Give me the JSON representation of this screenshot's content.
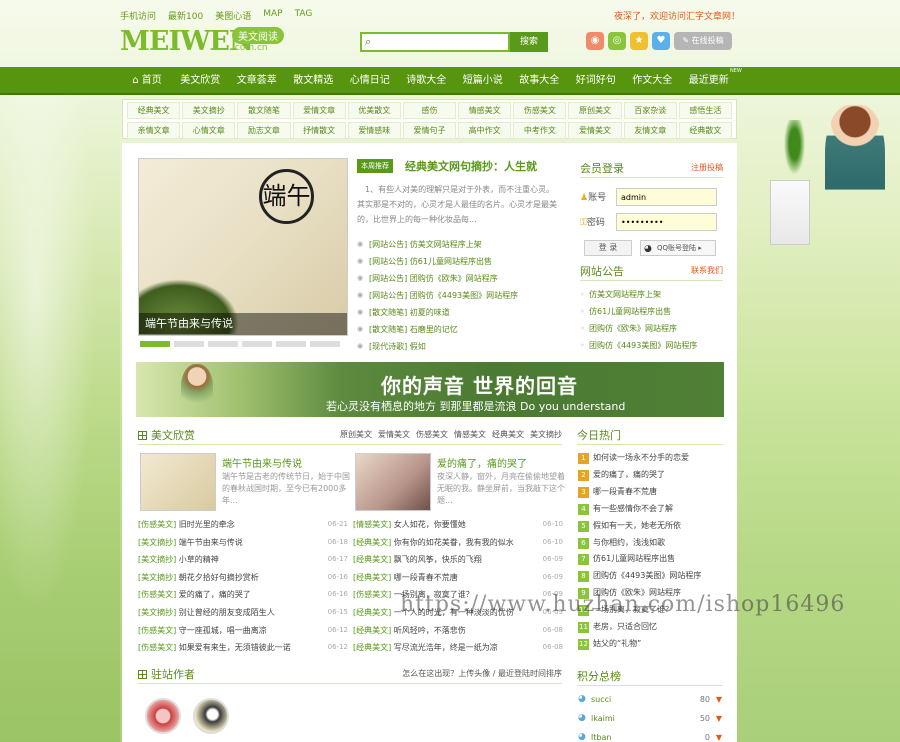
{
  "top_links": [
    "手机访问",
    "最新100",
    "美图心语",
    "MAP",
    "TAG"
  ],
  "welcome": "夜深了，欢迎访问汇字文章网！",
  "logo": {
    "text": "MEIWEN",
    "badge": "美文阅读",
    "domain": ".com.cn"
  },
  "search": {
    "placeholder": "",
    "button": "搜索"
  },
  "social": {
    "online_submit": "在线投稿"
  },
  "nav": {
    "items": [
      "首页",
      "美文欣赏",
      "文章荟萃",
      "散文精选",
      "心情日记",
      "诗歌大全",
      "短篇小说",
      "故事大全",
      "好词好句",
      "作文大全",
      "最近更新"
    ],
    "badge": "NEW"
  },
  "subnav": [
    "经典美文",
    "美文摘抄",
    "散文随笔",
    "爱情文章",
    "优美散文",
    "感伤",
    "情感美文",
    "伤感美文",
    "原创美文",
    "百家杂谈",
    "感悟生活",
    "亲情文章",
    "心情文章",
    "励志文章",
    "抒情散文",
    "爱情感味",
    "爱情句子",
    "高中作文",
    "中考作文",
    "爱情美文",
    "友情文章",
    "经典散文"
  ],
  "slider": {
    "caption": "端午节由来与传说",
    "brush_char": "端午"
  },
  "recommend": {
    "tag": "本周推荐",
    "title": "经典美文网句摘抄：人生就",
    "body": "1、有些人对美的理解只是对于外表，而不注重心灵。其实那是不对的，心灵才是人最佳的名片。心灵才是最美的，比世界上的每一种化妆品每..."
  },
  "notice_list": [
    "[网站公告] 仿美文网站程序上架",
    "[网站公告] 仿61儿童网站程序出售",
    "[网站公告] 团购仿《欧朱》网站程序",
    "[网站公告] 团购仿《4493美图》网站程序",
    "[散文随笔] 初夏的味道",
    "[散文随笔] 石磨里的记忆",
    "[现代诗歌] 假如"
  ],
  "login": {
    "title": "会员登录",
    "register": "注册投稿",
    "account_label": "账号",
    "account_value": "admin",
    "password_label": "密码",
    "password_value": "•••••••••",
    "login_button": "登 录",
    "qq_button": "QQ账号登陆"
  },
  "site_notice": {
    "title": "网站公告",
    "contact": "联系我们",
    "items": [
      "仿美文网站程序上架",
      "仿61儿童网站程序出售",
      "团购仿《欧朱》网站程序",
      "团购仿《4493美图》网站程序"
    ]
  },
  "banner": {
    "line1": "你的声音 世界的回音",
    "line2": "若心灵没有栖息的地方 到那里都是流浪 Do you understand"
  },
  "articles": {
    "title": "美文欣赏",
    "tabs": [
      "原创美文",
      "爱情美文",
      "伤感美文",
      "情感美文",
      "经典美文",
      "美文摘抄"
    ],
    "featured": [
      {
        "title": "端午节由来与传说",
        "desc": "端午节是古老的传统节日，始于中国的春秋战国时期，至今已有2000多年..."
      },
      {
        "title": "爱的痛了，痛的哭了",
        "desc": "夜深人静，窗外，月亮在偷偷地望着无眠的我。静坐屏前，当我敲下这个题..."
      }
    ],
    "left": [
      {
        "cat": "[伤感美文]",
        "title": "旧时光里的牵念",
        "date": "06-21"
      },
      {
        "cat": "[美文摘抄]",
        "title": "端午节由来与传说",
        "date": "06-18"
      },
      {
        "cat": "[美文摘抄]",
        "title": "小草的精神",
        "date": "06-17"
      },
      {
        "cat": "[美文摘抄]",
        "title": "朝花夕拾好句摘抄赏析",
        "date": "06-16"
      },
      {
        "cat": "[伤感美文]",
        "title": "爱的痛了，痛的哭了",
        "date": "06-16"
      },
      {
        "cat": "[美文摘抄]",
        "title": "别让曾经的朋友变成陌生人",
        "date": "06-15"
      },
      {
        "cat": "[伤感美文]",
        "title": "守一座孤城，唱一曲离凉",
        "date": "06-12"
      },
      {
        "cat": "[伤感美文]",
        "title": "如果爱有来生，无须错彼此一诺",
        "date": "06-12"
      }
    ],
    "right": [
      {
        "cat": "[情感美文]",
        "title": "女人如花，你要懂她",
        "date": "06-10"
      },
      {
        "cat": "[经典美文]",
        "title": "你有你的如花美眷，我有我的似水",
        "date": "06-10"
      },
      {
        "cat": "[经典美文]",
        "title": "飘飞的风筝，快乐的飞翔",
        "date": "06-09"
      },
      {
        "cat": "[经典美文]",
        "title": "哪一段青春不荒唐",
        "date": "06-09"
      },
      {
        "cat": "[伤感美文]",
        "title": "一场别离，寂寞了谁？",
        "date": "06-09"
      },
      {
        "cat": "[经典美文]",
        "title": "一个人的时光，有一种淡淡的忧伤",
        "date": "06-09"
      },
      {
        "cat": "[经典美文]",
        "title": "听风轻吟，不落悲伤",
        "date": "06-08"
      },
      {
        "cat": "[经典美文]",
        "title": "写尽流光浩年，终是一纸为凉",
        "date": "06-08"
      }
    ]
  },
  "hot": {
    "title": "今日热门",
    "items": [
      "如何读一场永不分手的恋爱",
      "爱的痛了，痛的哭了",
      "哪一段青春不荒唐",
      "有一些感情你不会了解",
      "假如有一天，她老无所依",
      "与你相约，浅浅如歌",
      "仿61儿童网站程序出售",
      "团购仿《4493美图》网站程序",
      "团购仿《欧朱》网站程序",
      "一场别离，寂寞了谁？",
      "老房，只适合回忆",
      "姑父的“礼物”"
    ]
  },
  "writers": {
    "title": "驻站作者",
    "hint": "怎么在这出现？上传头像 / 最近登陆时间排序"
  },
  "score": {
    "title": "积分总榜",
    "items": [
      {
        "name": "succi",
        "points": "80"
      },
      {
        "name": "lkaimi",
        "points": "50"
      },
      {
        "name": "ltban",
        "points": "0"
      }
    ]
  },
  "watermark": "https://www.huzhan.com/ishop16496",
  "colors": {
    "brand": "#58950f",
    "accent": "#7cbb2b",
    "orange": "#e05a1a"
  }
}
